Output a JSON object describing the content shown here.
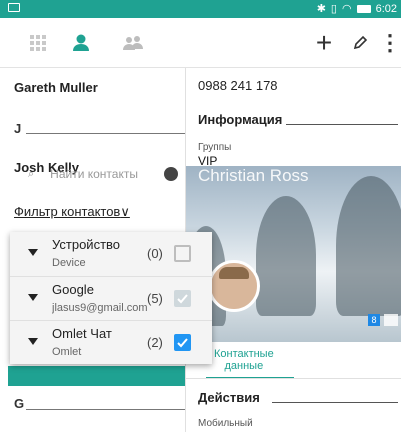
{
  "toolbar": {
    "add_icon": "plus-icon",
    "add_label": "+",
    "menu_label": "⋮"
  },
  "contacts": {
    "first_name": "Gareth Muller",
    "letter_j": "J",
    "second_name": "Josh Kelly",
    "letter_g": "G"
  },
  "search": {
    "placeholder": "Найти контакты"
  },
  "filter": {
    "label": "Фильтр контактов"
  },
  "accounts": [
    {
      "name": "Устройство",
      "sub": "Device",
      "count": "(0)",
      "checked": false
    },
    {
      "name": "Google",
      "sub": "jlasus9@gmail.com",
      "count": "(5)",
      "checked": true
    },
    {
      "name": "Omlet Чат",
      "sub": "Omlet",
      "count": "(2)",
      "checked": true
    }
  ],
  "detail": {
    "phone": "0988 241 178",
    "info_title": "Информация",
    "groups_label": "Группы",
    "groups_value": "VIP",
    "contact_name": "Christian Ross",
    "tab_label_1": "Контактные",
    "tab_label_2": "данные",
    "actions_title": "Действия",
    "mobile_label": "Мобильный",
    "google_badge": "8"
  },
  "colors": {
    "accent": "#1fa292",
    "checkbox": "#2196f3"
  }
}
